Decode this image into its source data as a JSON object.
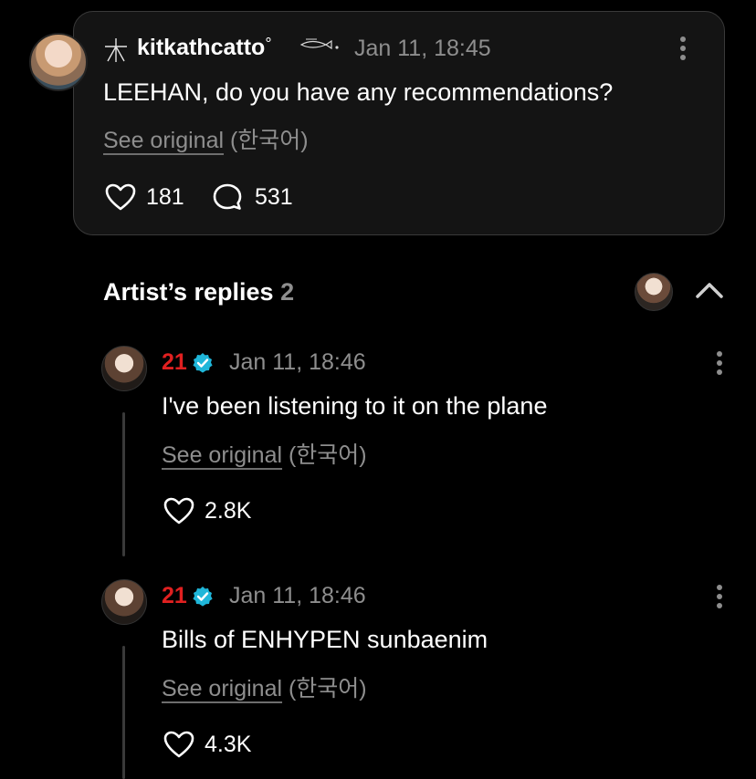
{
  "post": {
    "username": "kitkathcatto",
    "username_suffix": "°",
    "timestamp": "Jan 11, 18:45",
    "text": "LEEHAN, do you have any recommendations?",
    "see_original": "See original",
    "language": "(한국어)",
    "likes": "181",
    "comments": "531",
    "icons": {
      "star": "star-outline-icon",
      "decoration": "fish-sparkle-icon",
      "menu": "more-vertical-icon",
      "like": "heart-icon",
      "comment": "comment-bubble-icon"
    }
  },
  "replies_header": {
    "title": "Artist’s replies",
    "count": "2",
    "collapse_icon": "chevron-up-icon"
  },
  "replies": [
    {
      "name": "21",
      "timestamp": "Jan 11, 18:46",
      "text": "I've been listening to it on the plane",
      "see_original": "See original",
      "language": "(한국어)",
      "likes": "2.8K"
    },
    {
      "name": "21",
      "timestamp": "Jan 11, 18:46",
      "text": "Bills of ENHYPEN sunbaenim",
      "see_original": "See original",
      "language": "(한국어)",
      "likes": "4.3K"
    }
  ],
  "colors": {
    "background": "#000000",
    "card": "#141414",
    "muted": "#8e8e8e",
    "artist_name": "#e02020",
    "verified": "#1fb6d9"
  }
}
